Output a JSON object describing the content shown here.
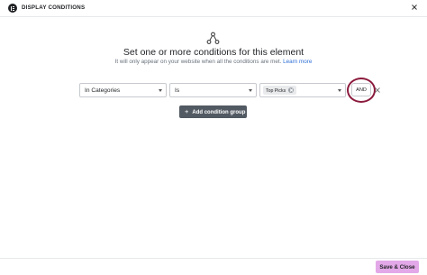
{
  "header": {
    "title": "DISPLAY CONDITIONS",
    "logo_icon": "elementor-logo-icon",
    "close_icon": "close-icon"
  },
  "main": {
    "icon": "conditions-tree-icon",
    "headline": "Set one or more conditions for this element",
    "subline": "It will only appear on your website when all the conditions are met.",
    "learn_more": "Learn more",
    "condition_row": {
      "field_select": "In Categories",
      "operator_select": "Is",
      "value_chips": [
        "Top Picks"
      ],
      "and_label": "AND"
    },
    "add_group_label": "Add condition group"
  },
  "footer": {
    "save_label": "Save & Close"
  },
  "colors": {
    "accent_button": "#e3a8e8",
    "highlight_ring": "#8b1a3c",
    "link": "#2f6fd6",
    "dark_button": "#515962"
  }
}
